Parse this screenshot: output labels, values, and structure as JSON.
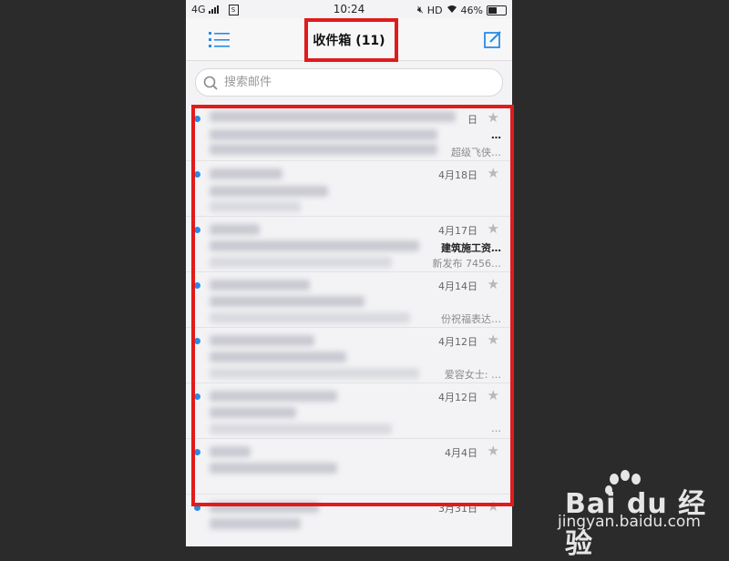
{
  "status_bar": {
    "network": "4G",
    "sim": "S",
    "time": "10:24",
    "hd": "HD",
    "battery": "46%"
  },
  "header": {
    "title": "收件箱 (11)"
  },
  "search": {
    "placeholder": "搜索邮件"
  },
  "emails": [
    {
      "date": "日",
      "subject": "…",
      "preview": "超级飞侠…",
      "unread": true
    },
    {
      "date": "4月18日",
      "subject": "",
      "preview": "",
      "unread": true
    },
    {
      "date": "4月17日",
      "subject": "建筑施工资…",
      "preview": "新发布 7456…",
      "unread": true
    },
    {
      "date": "4月14日",
      "subject": "",
      "preview": "份祝福表达…",
      "unread": true
    },
    {
      "date": "4月12日",
      "subject": "",
      "preview": "爱容女士: …",
      "unread": true
    },
    {
      "date": "4月12日",
      "subject": "",
      "preview": "…",
      "unread": true
    },
    {
      "date": "4月4日",
      "subject": "",
      "preview": "",
      "unread": true
    },
    {
      "date": "3月31日",
      "subject": "",
      "preview": "",
      "unread": true
    }
  ],
  "watermark": {
    "brand": "Bai du 经验",
    "url": "jingyan.baidu.com"
  },
  "colors": {
    "accent": "#2a8ae6",
    "highlight": "#e01b1b"
  }
}
